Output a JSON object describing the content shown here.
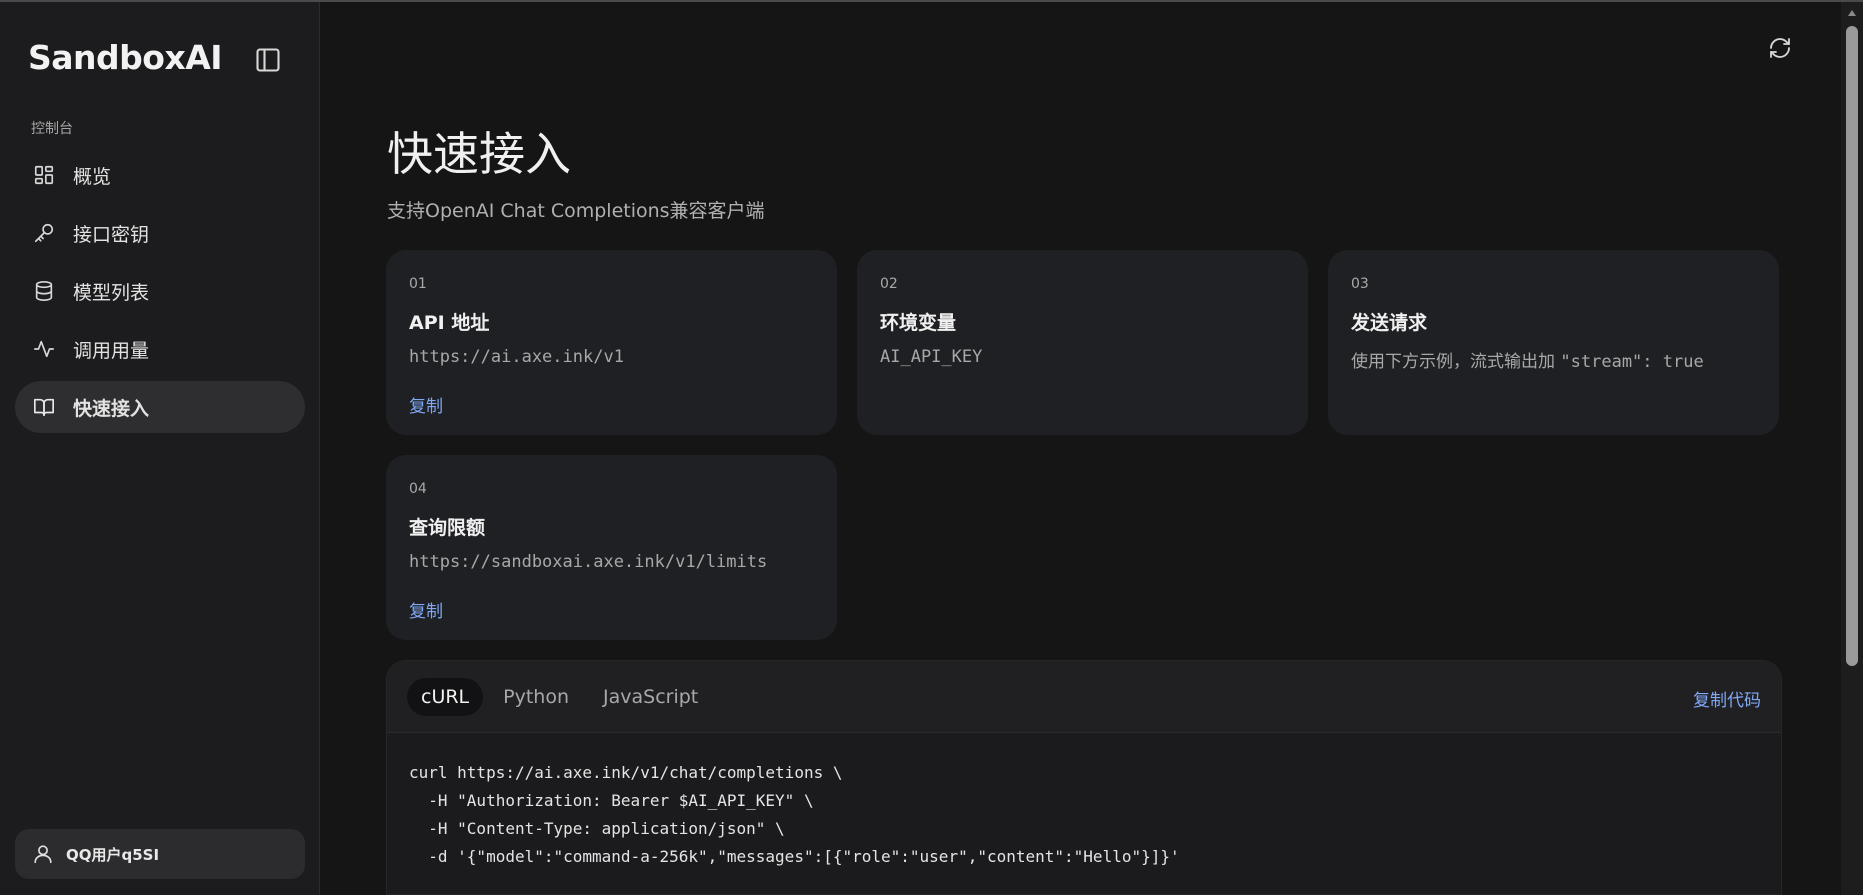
{
  "app": {
    "brand": "SandboxAI"
  },
  "sidebar": {
    "section_label": "控制台",
    "items": [
      {
        "label": "概览",
        "icon": "grid-icon",
        "active": false
      },
      {
        "label": "接口密钥",
        "icon": "key-icon",
        "active": false
      },
      {
        "label": "模型列表",
        "icon": "database-icon",
        "active": false
      },
      {
        "label": "调用用量",
        "icon": "activity-icon",
        "active": false
      },
      {
        "label": "快速接入",
        "icon": "book-icon",
        "active": true
      }
    ],
    "user": {
      "name": "QQ用户q5SI",
      "icon": "user-icon"
    }
  },
  "header": {
    "refresh_icon": "refresh-icon"
  },
  "page": {
    "title": "快速接入",
    "subtitle": "支持OpenAI Chat Completions兼容客户端"
  },
  "cards": [
    {
      "num": "01",
      "title": "API 地址",
      "value": "https://ai.axe.ink/v1",
      "action": "复制"
    },
    {
      "num": "02",
      "title": "环境变量",
      "value": "AI_API_KEY"
    },
    {
      "num": "03",
      "title": "发送请求",
      "value_prefix": "使用下方示例，流式输出加 ",
      "value_code": "\"stream\": true"
    },
    {
      "num": "04",
      "title": "查询限额",
      "value": "https://sandboxai.axe.ink/v1/limits",
      "action": "复制"
    }
  ],
  "code_panel": {
    "tabs": [
      "cURL",
      "Python",
      "JavaScript"
    ],
    "active_tab": "cURL",
    "copy_label": "复制代码",
    "lines": [
      "curl https://ai.axe.ink/v1/chat/completions \\",
      "  -H \"Authorization: Bearer $AI_API_KEY\" \\",
      "  -H \"Content-Type: application/json\" \\",
      "  -d '{\"model\":\"command-a-256k\",\"messages\":[{\"role\":\"user\",\"content\":\"Hello\"}]}'"
    ]
  },
  "colors": {
    "accent": "#7fa8f5",
    "background": "#151515",
    "sidebar": "#1c1c1e",
    "card": "#1f2023"
  }
}
